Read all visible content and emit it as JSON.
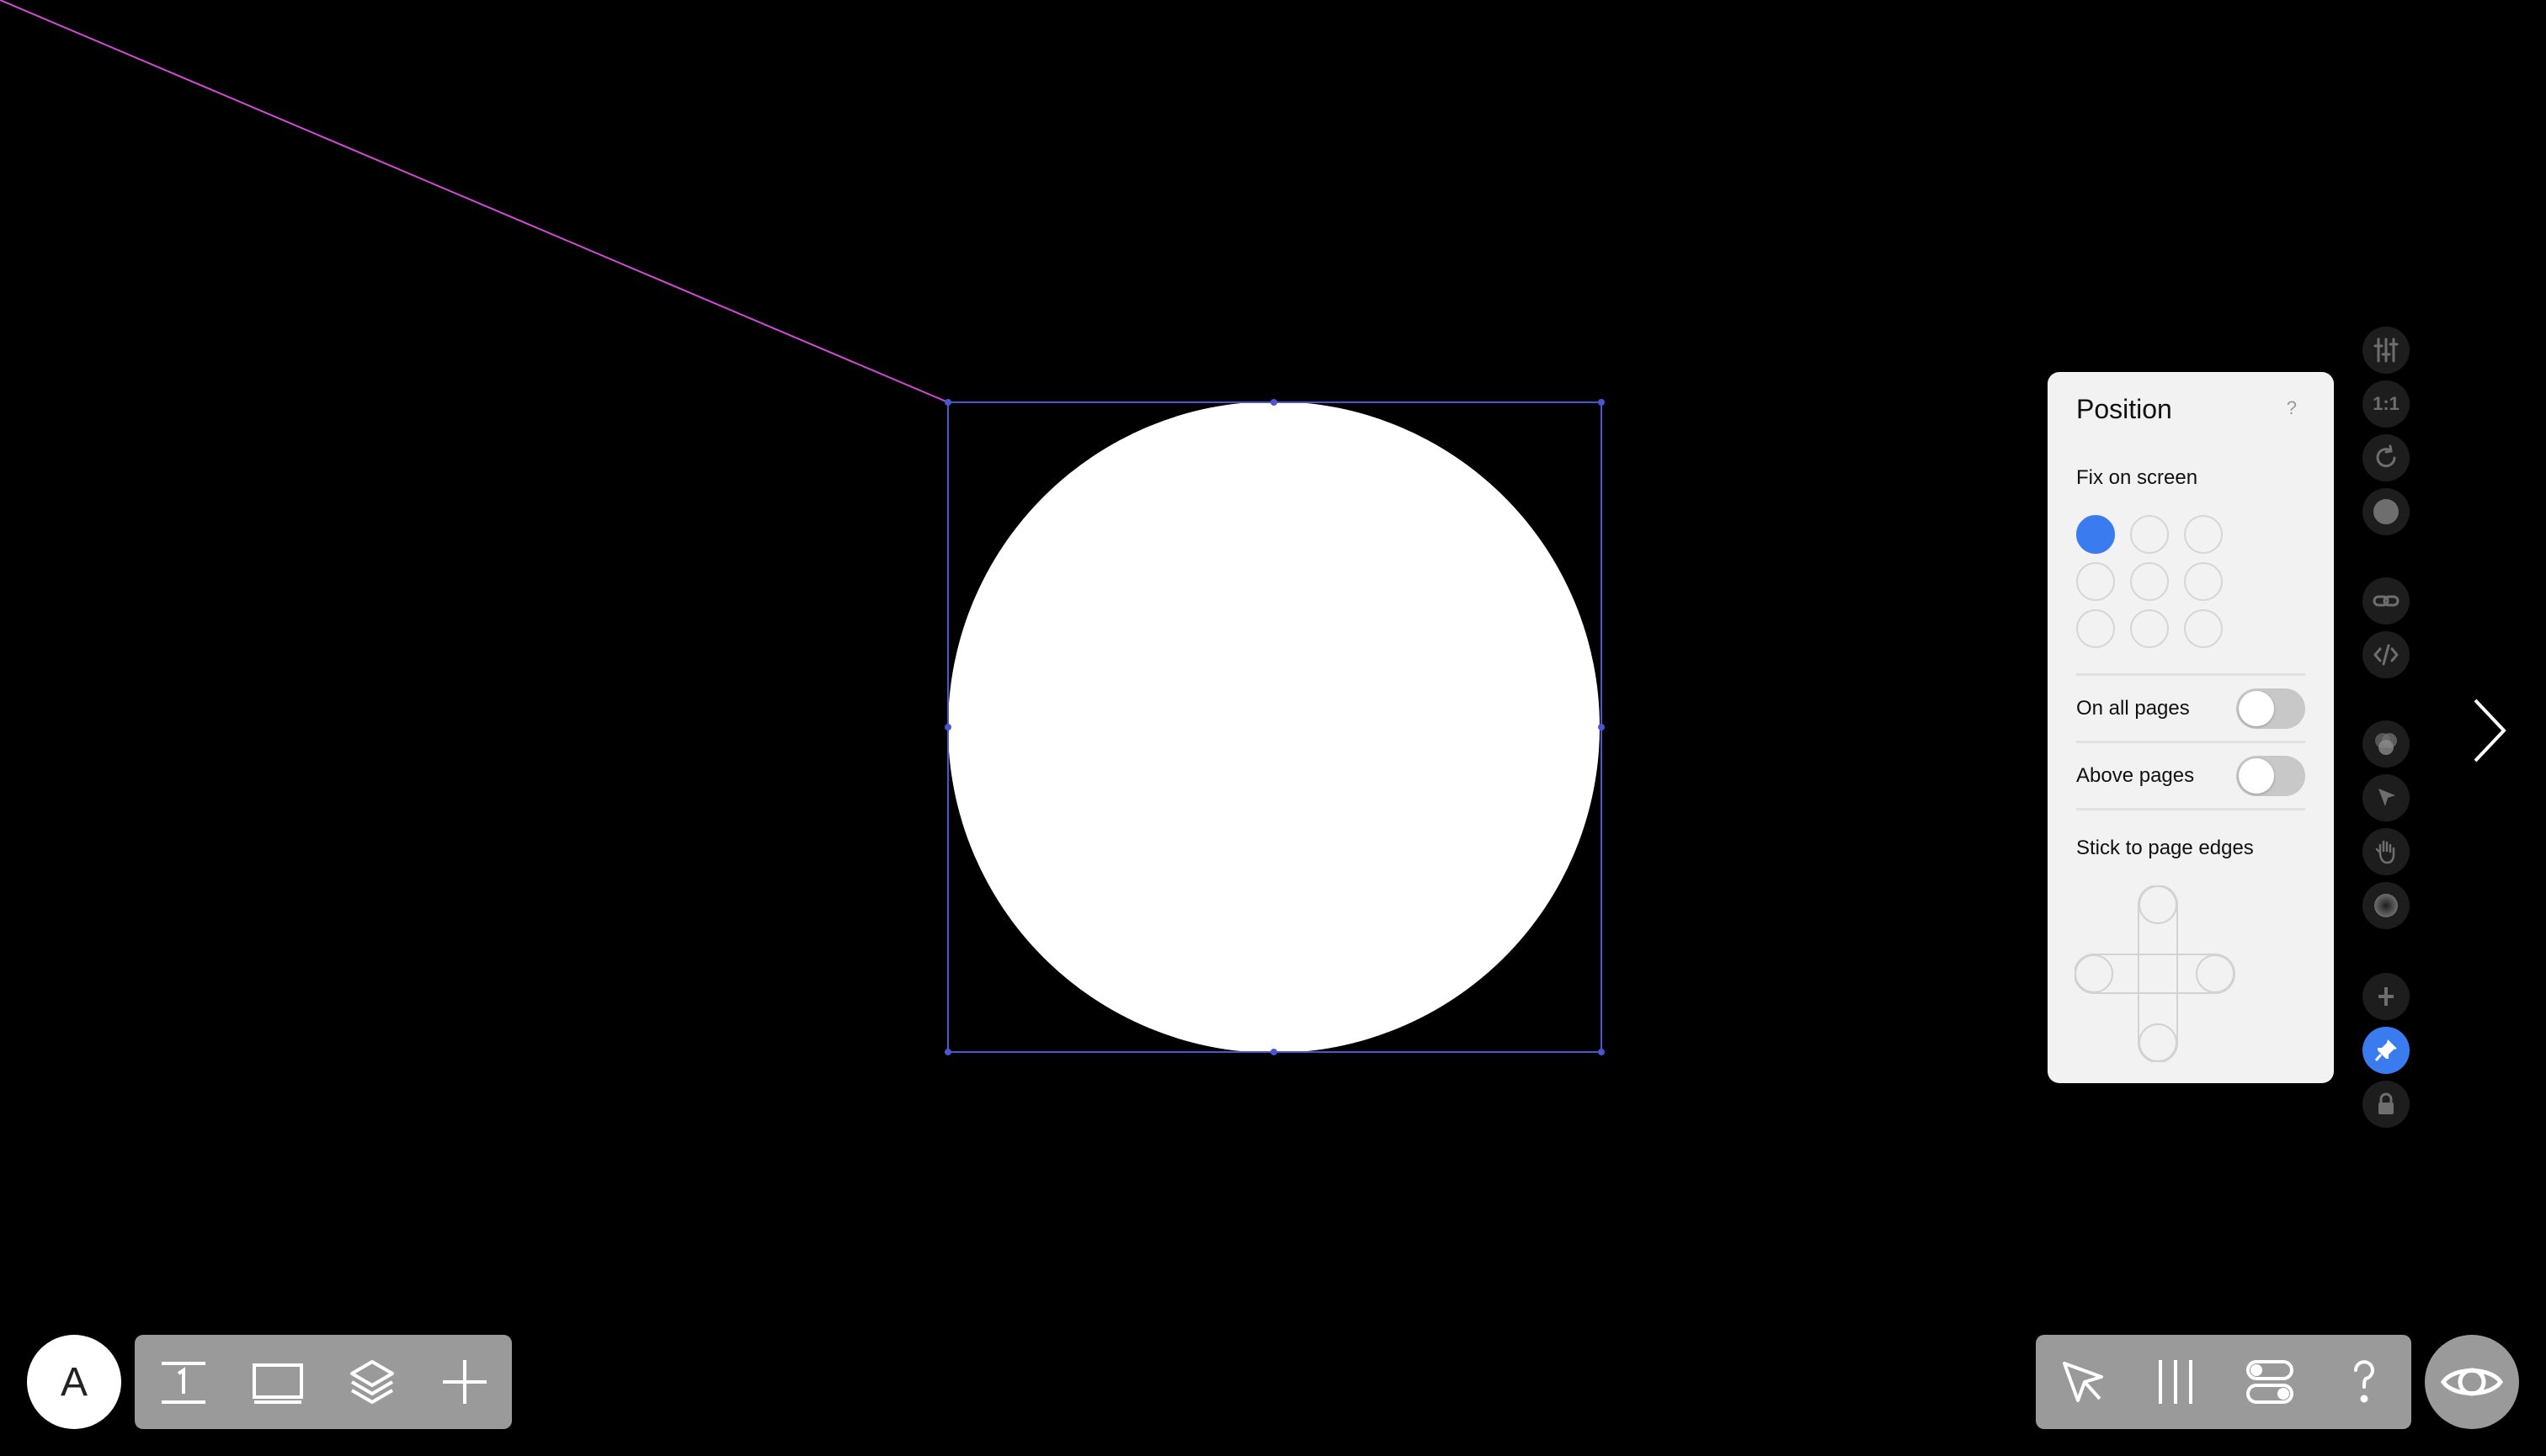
{
  "position_panel": {
    "title": "Position",
    "help": "?",
    "fix_on_screen_label": "Fix on screen",
    "selected_anchor": "top-left",
    "on_all_pages_label": "On all pages",
    "on_all_pages_enabled": false,
    "above_pages_label": "Above pages",
    "above_pages_enabled": false,
    "stick_to_edges_label": "Stick to page edges"
  },
  "side_tools": [
    {
      "name": "adjust-icon"
    },
    {
      "name": "ratio-icon",
      "label": "1:1"
    },
    {
      "name": "rotate-icon"
    },
    {
      "name": "fill-color-icon"
    },
    {
      "name": "link-icon"
    },
    {
      "name": "code-icon"
    },
    {
      "name": "blend-icon"
    },
    {
      "name": "cursor-icon"
    },
    {
      "name": "hand-icon"
    },
    {
      "name": "shadow-icon"
    },
    {
      "name": "add-icon"
    },
    {
      "name": "pin-icon",
      "active": true
    },
    {
      "name": "lock-icon"
    }
  ],
  "avatar": {
    "initial": "A"
  },
  "toolbar_left": [
    "page-number-icon",
    "frame-icon",
    "layers-icon",
    "add-icon"
  ],
  "toolbar_right": [
    "select-icon",
    "columns-icon",
    "toggles-icon",
    "help-icon"
  ],
  "colors": {
    "accent": "#3a7cf0",
    "guide_line": "#d44ad4",
    "selection": "#4a55d0"
  }
}
